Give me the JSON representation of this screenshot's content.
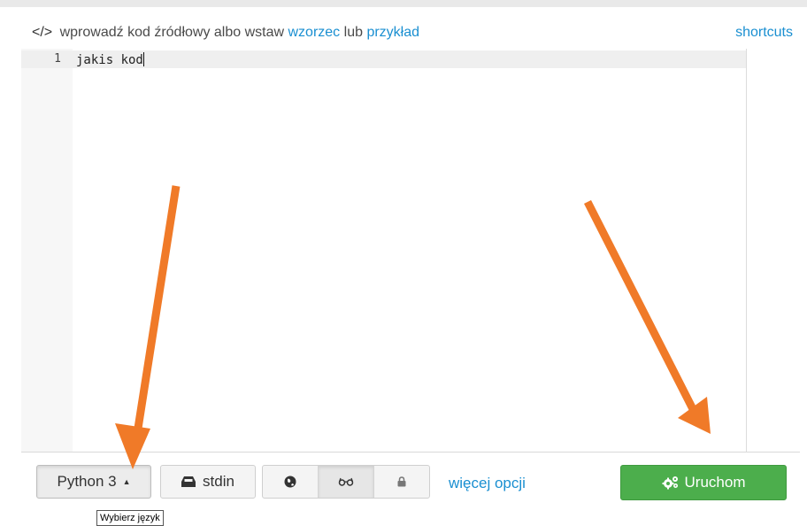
{
  "header": {
    "prefix_icon": "code-brackets-icon",
    "prefix_glyph": "</>",
    "text_before": "wprowadź kod źródłowy albo wstaw",
    "template_link": "wzorzec",
    "text_middle": "lub",
    "example_link": "przykład",
    "shortcuts_link": "shortcuts"
  },
  "editor": {
    "line_number": "1",
    "code": "jakis kod"
  },
  "toolbar": {
    "language_label": "Python 3",
    "language_caret": "▲",
    "stdin_label": "stdin",
    "stdin_icon": "inbox-icon",
    "visibility_options": [
      {
        "icon": "globe-icon",
        "glyph": "●",
        "active": false
      },
      {
        "icon": "glasses-icon",
        "glyph": "◌",
        "active": true
      },
      {
        "icon": "lock-icon",
        "glyph": "🔒",
        "active": false
      }
    ],
    "more_options": "więcej opcji",
    "run_label": "Uruchom",
    "run_icon": "gears-icon"
  },
  "tooltip": {
    "text": "Wybierz język"
  },
  "colors": {
    "link": "#1a8fd1",
    "run_button": "#4cae4c",
    "annotation_arrow": "#f07a28"
  }
}
